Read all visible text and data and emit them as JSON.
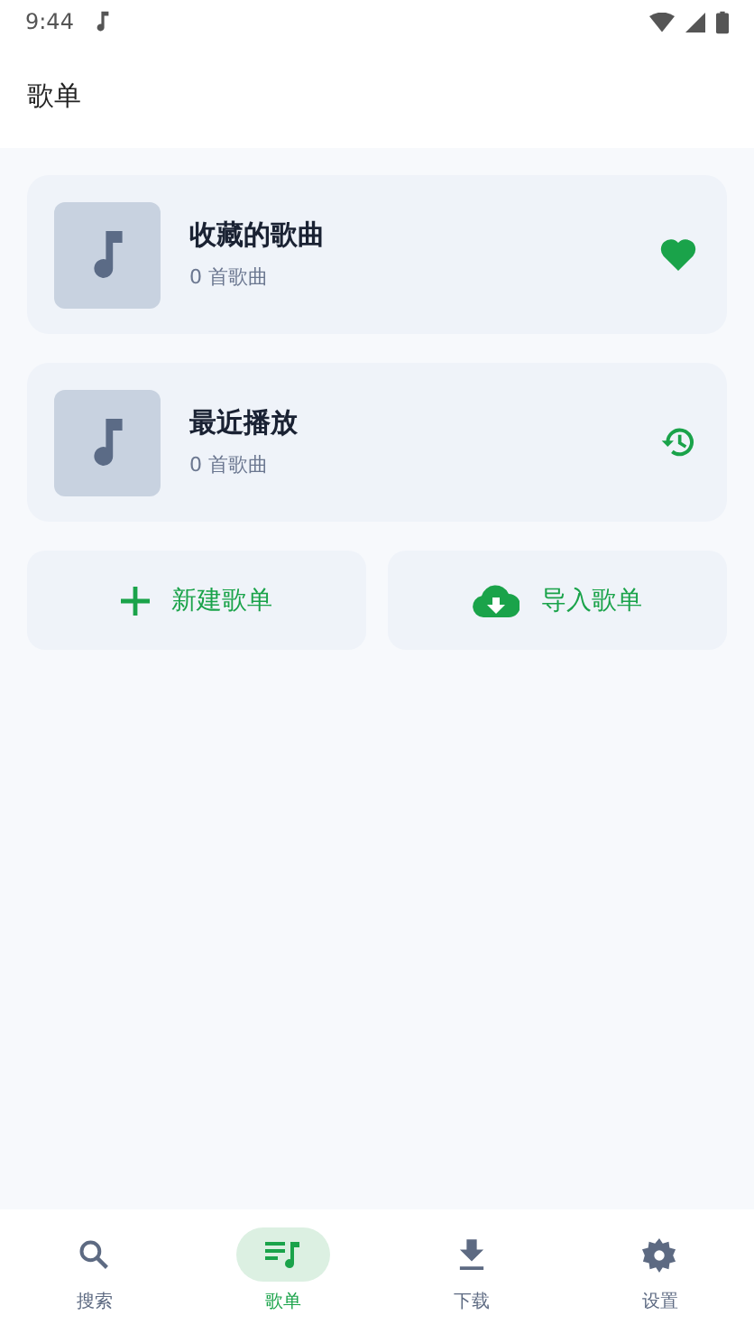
{
  "status_bar": {
    "time": "9:44"
  },
  "header": {
    "title": "歌单"
  },
  "playlists": [
    {
      "title": "收藏的歌曲",
      "count": "0 首歌曲",
      "kind": "favorites"
    },
    {
      "title": "最近播放",
      "count": "0 首歌曲",
      "kind": "recent"
    }
  ],
  "actions": [
    {
      "label": "新建歌单",
      "kind": "create"
    },
    {
      "label": "导入歌单",
      "kind": "import"
    }
  ],
  "bottom_nav": [
    {
      "label": "搜索",
      "kind": "search",
      "selected": false
    },
    {
      "label": "歌单",
      "kind": "playlists",
      "selected": true
    },
    {
      "label": "下载",
      "kind": "download",
      "selected": false
    },
    {
      "label": "设置",
      "kind": "settings",
      "selected": false
    }
  ]
}
